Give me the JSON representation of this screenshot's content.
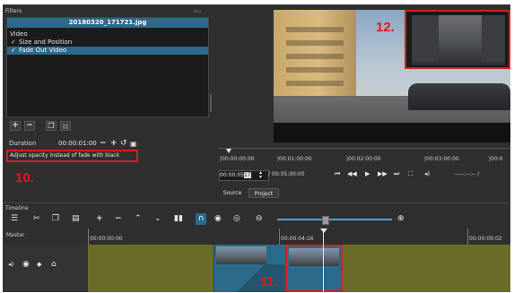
{
  "filters": {
    "panel_title": "Filters",
    "clip_name": "20180320_171721.jpg",
    "group_label": "Video",
    "items": [
      {
        "check": "✓",
        "label": "Size and Position"
      },
      {
        "check": "✓",
        "label": "Fade Out Video"
      }
    ],
    "duration_label": "Duration",
    "duration_value": "00:00:01:00",
    "checkbox_label": "Adjust opacity instead of fade with black"
  },
  "player": {
    "timecode_ticks": [
      "|00:00:00:00",
      "|00:01:00:00",
      "|00:02:00:00",
      "|00:03:00:00",
      "|00:0"
    ],
    "current_position": "00:00:05",
    "frame_value": "17",
    "total_duration": "/ 00:05:00:00",
    "in_out_display": "--:--:--:-- /",
    "tabs": [
      "Source",
      "Project"
    ]
  },
  "timeline": {
    "panel_title": "Timeline",
    "track_name": "Master",
    "ruler_ticks": [
      "00:00:00:00",
      "00:00:04:16",
      "00:00:09:02"
    ]
  },
  "annotations": {
    "a10": "10.",
    "a11": "11.",
    "a12": "12."
  },
  "colors": {
    "panel_bg": "#2f2f2f",
    "selection": "#2b6a8a",
    "track": "#6b6b28",
    "annotation_red": "#d81e1e",
    "playhead_accent": "#4fa3d1"
  }
}
